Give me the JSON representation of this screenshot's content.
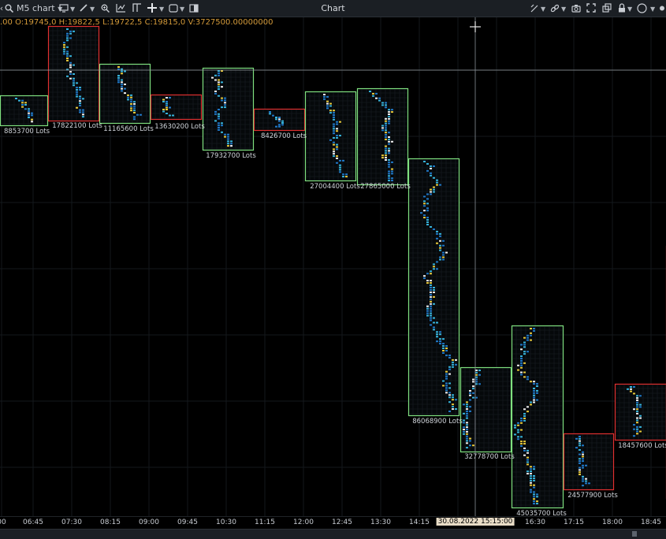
{
  "window": {
    "title": "Chart"
  },
  "toolbar": {
    "chart_selector_label": "M5 chart",
    "left_icons": [
      "search-icon",
      "chart-type-icon",
      "draw-tool-icon",
      "zoom-icon",
      "indicator-icon",
      "template-icon",
      "crosshair-icon",
      "layout-icon",
      "panel-icon"
    ],
    "right_icons": [
      "magnet-icon",
      "link-icon",
      "camera-icon",
      "fullscreen-icon",
      "detach-icon",
      "lock-icon",
      "theme-icon",
      "settings-icon"
    ]
  },
  "ohlc_readout": ".00 O:19745,0 H:19822,5 L:19722,5 C:19815,0 V:3727500.00000000",
  "time_axis": {
    "labels": [
      "00",
      "06:45",
      "07:30",
      "08:15",
      "09:00",
      "09:45",
      "10:30",
      "11:15",
      "12:00",
      "12:45",
      "13:30",
      "14:15",
      "16:30",
      "17:15",
      "18:00",
      "18:45"
    ],
    "cursor_label": "30.08.2022 15:15:00"
  },
  "colors": {
    "bull_box": "#7fe07f",
    "bear_box": "#e03030",
    "cell_blue": "#1f78c8",
    "cell_cyan": "#36b4dc",
    "cell_yellow": "#e8c93a",
    "cell_white": "#f0f0f0",
    "volume_label": "#d0d4da",
    "background": "#000000"
  },
  "chart_data": {
    "type": "footprint",
    "bars": [
      {
        "dir": "bull",
        "label": "8853700 Lots"
      },
      {
        "dir": "bear",
        "label": "17822100 Lots"
      },
      {
        "dir": "bull",
        "label": "11165600 Lots"
      },
      {
        "dir": "bear",
        "label": "13630200 Lots"
      },
      {
        "dir": "bull",
        "label": "17932700 Lots"
      },
      {
        "dir": "bear",
        "label": "8426700 Lots"
      },
      {
        "dir": "bull",
        "label": "27004400 Lots"
      },
      {
        "dir": "bull",
        "label": "27865000 Lots"
      },
      {
        "dir": "bull",
        "label": "86068900 Lots"
      },
      {
        "dir": "bull",
        "label": "32778700 Lots"
      },
      {
        "dir": "bull",
        "label": "45035700 Lots"
      },
      {
        "dir": "bear",
        "label": "24577900 Lots"
      },
      {
        "dir": "bear",
        "label": "18457600 Lots"
      },
      {
        "dir": "bear",
        "label": ""
      }
    ]
  }
}
